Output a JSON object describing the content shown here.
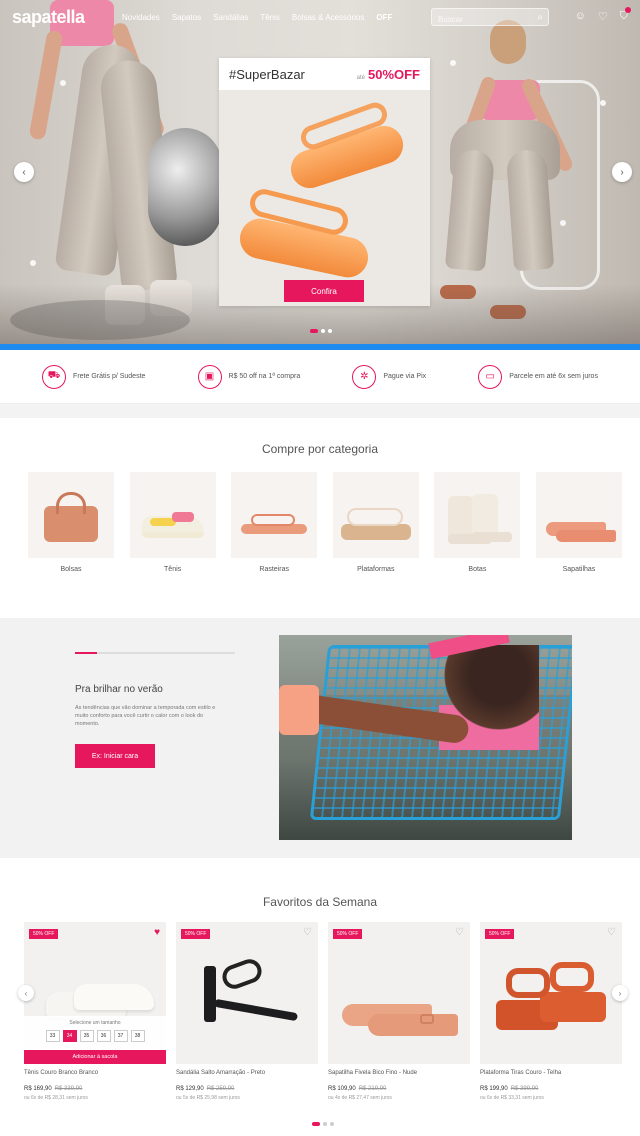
{
  "header": {
    "logo": "sapatella",
    "nav": [
      "Novidades",
      "Sapatos",
      "Sandálias",
      "Tênis",
      "Bolsas & Acessórios",
      "OFF"
    ],
    "search_placeholder": "Buscar"
  },
  "hero": {
    "promo_title": "#SuperBazar",
    "promo_prefix": "até",
    "promo_off": "50%OFF",
    "promo_button": "Confira",
    "dots": 3,
    "active_dot": 0
  },
  "benefits": [
    {
      "icon": "truck-icon",
      "glyph": "⛟",
      "label": "Frete Grátis p/ Sudeste"
    },
    {
      "icon": "coupon-icon",
      "glyph": "▣",
      "label": "R$ 50 off na 1ª compra"
    },
    {
      "icon": "pix-icon",
      "glyph": "✲",
      "label": "Pague via Pix"
    },
    {
      "icon": "card-icon",
      "glyph": "▭",
      "label": "Parcele em até 6x sem juros"
    }
  ],
  "categories": {
    "title": "Compre por categoria",
    "items": [
      {
        "label": "Bolsas"
      },
      {
        "label": "Tênis"
      },
      {
        "label": "Rasteiras"
      },
      {
        "label": "Plataformas"
      },
      {
        "label": "Botas"
      },
      {
        "label": "Sapatilhas"
      }
    ]
  },
  "editorial": {
    "title": "Pra brilhar no verão",
    "text": "As tendências que vão dominar a temporada com estilo e muito conforto para você curtir o calor com o look do momento.",
    "button": "Ex: Iniciar cara"
  },
  "favorites": {
    "title": "Favoritos da Semana",
    "size_prompt": "Selecione um tamanho",
    "sizes": [
      "33",
      "34",
      "35",
      "36",
      "37",
      "38"
    ],
    "selected_size": "34",
    "add_button": "Adicionar à sacola",
    "products": [
      {
        "badge": "50% OFF",
        "name": "Tênis Couro Branco Branco",
        "price": "R$ 169,90",
        "old_price": "R$ 339,90",
        "installments": "ou 6x de R$ 28,31 sem juros",
        "favorited": true
      },
      {
        "badge": "50% OFF",
        "name": "Sandália Salto Amarração - Preto",
        "price": "R$ 129,90",
        "old_price": "R$ 259,90",
        "installments": "ou 5x de R$ 25,98 sem juros",
        "favorited": false
      },
      {
        "badge": "50% OFF",
        "name": "Sapatilha Fivela Bico Fino - Nude",
        "price": "R$ 109,90",
        "old_price": "R$ 219,90",
        "installments": "ou 4x de R$ 27,47 sem juros",
        "favorited": false
      },
      {
        "badge": "50% OFF",
        "name": "Plataforma Tiras Couro - Telha",
        "price": "R$ 199,90",
        "old_price": "R$ 399,90",
        "installments": "ou 6x de R$ 33,31 sem juros",
        "favorited": false
      }
    ]
  },
  "colors": {
    "accent": "#e6175c",
    "hero_bar": "#1d8bf0"
  }
}
